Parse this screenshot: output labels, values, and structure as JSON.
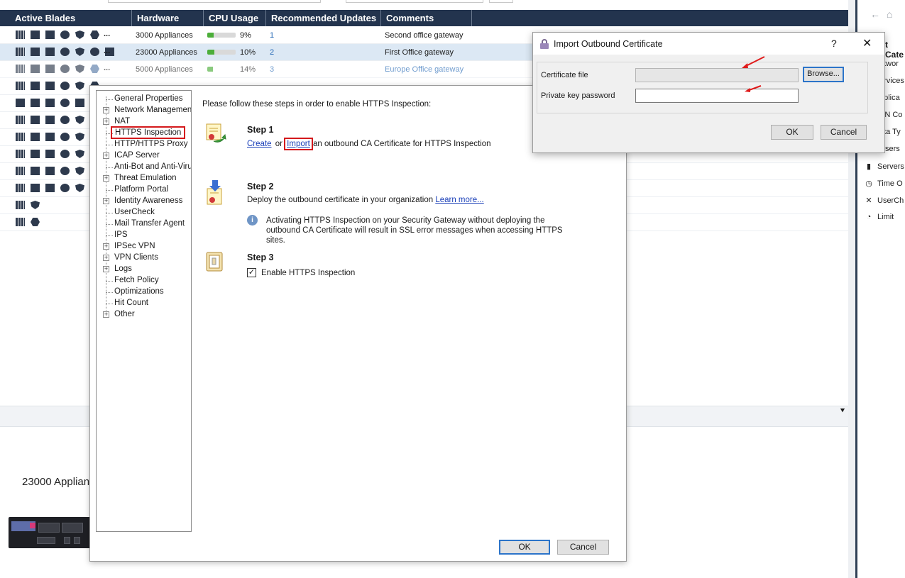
{
  "table": {
    "headers": [
      "Active Blades",
      "Hardware",
      "CPU Usage",
      "Recommended Updates",
      "Comments"
    ],
    "rows": [
      {
        "more": "...",
        "hardware": "3000 Appliances",
        "cpu_pct": "9%",
        "cpu_value": 0.09,
        "updates": "1",
        "comment": "Second office gateway"
      },
      {
        "more": "...",
        "hardware": "23000 Appliances",
        "cpu_pct": "10%",
        "cpu_value": 0.1,
        "updates": "2",
        "comment": "First Office gateway"
      },
      {
        "more": "...",
        "hardware": "5000 Appliances",
        "cpu_pct": "14%",
        "cpu_value": 0.14,
        "updates": "3",
        "comment": "Europe Office gateway"
      }
    ]
  },
  "details": {
    "appliance_label": "23000 Applian"
  },
  "right_panel": {
    "title": "t Cate",
    "items": [
      {
        "label": "etwor",
        "icon": "network-icon"
      },
      {
        "label": "ervices",
        "icon": "services-icon"
      },
      {
        "label": "pplica",
        "icon": "applications-icon"
      },
      {
        "label": "PN Co",
        "icon": "vpn-icon"
      },
      {
        "label": "ata Ty",
        "icon": "data-type-icon"
      },
      {
        "label": "sers",
        "icon": "users-icon"
      },
      {
        "label": "Servers",
        "icon": "servers-icon"
      },
      {
        "label": "Time O",
        "icon": "time-icon"
      },
      {
        "label": "UserCh",
        "icon": "usercheck-icon"
      },
      {
        "label": "Limit",
        "icon": "limit-icon"
      }
    ]
  },
  "gateway_dialog": {
    "tree": [
      {
        "label": "General Properties",
        "expandable": false
      },
      {
        "label": "Network Management",
        "expandable": true
      },
      {
        "label": "NAT",
        "expandable": true
      },
      {
        "label": "HTTPS Inspection",
        "expandable": false
      },
      {
        "label": "HTTP/HTTPS Proxy",
        "expandable": false
      },
      {
        "label": "ICAP Server",
        "expandable": true
      },
      {
        "label": "Anti-Bot and Anti-Virus",
        "expandable": false
      },
      {
        "label": "Threat Emulation",
        "expandable": true
      },
      {
        "label": "Platform Portal",
        "expandable": false
      },
      {
        "label": "Identity Awareness",
        "expandable": true
      },
      {
        "label": "UserCheck",
        "expandable": false
      },
      {
        "label": "Mail Transfer Agent",
        "expandable": false
      },
      {
        "label": "IPS",
        "expandable": false
      },
      {
        "label": "IPSec VPN",
        "expandable": true
      },
      {
        "label": "VPN Clients",
        "expandable": true
      },
      {
        "label": "Logs",
        "expandable": true
      },
      {
        "label": "Fetch Policy",
        "expandable": false
      },
      {
        "label": "Optimizations",
        "expandable": false
      },
      {
        "label": "Hit Count",
        "expandable": false
      },
      {
        "label": "Other",
        "expandable": true
      }
    ],
    "intro": "Please follow these steps in order to enable HTTPS Inspection:",
    "step1": {
      "title": "Step 1",
      "create": "Create",
      "or": "or",
      "import": "Import",
      "rest": "an outbound CA Certificate for HTTPS Inspection"
    },
    "step2": {
      "title": "Step 2",
      "text": "Deploy the outbound certificate in your organization",
      "link": "Learn more...",
      "info": "Activating HTTPS Inspection on your Security Gateway without deploying the outbound CA Certificate will result in SSL error messages when accessing HTTPS sites."
    },
    "step3": {
      "title": "Step 3",
      "checkbox_label": "Enable HTTPS Inspection",
      "checked": true
    },
    "ok": "OK",
    "cancel": "Cancel"
  },
  "import_dialog": {
    "title": "Import Outbound Certificate",
    "help": "?",
    "close": "✕",
    "cert_label": "Certificate file",
    "cert_value": "",
    "browse": "Browse...",
    "pwd_label": "Private key password",
    "pwd_value": "",
    "ok": "OK",
    "cancel": "Cancel"
  }
}
